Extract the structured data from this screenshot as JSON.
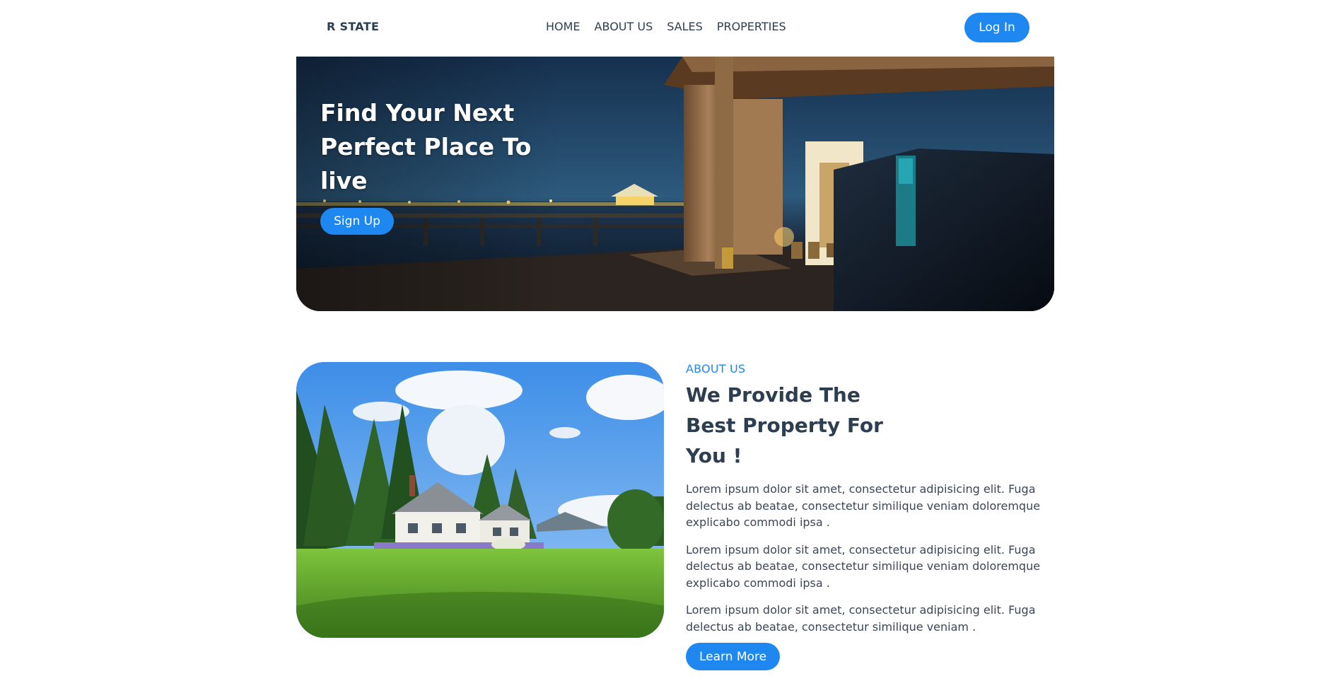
{
  "navbar": {
    "brand": "R STATE",
    "links": [
      "HOME",
      "ABOUT US",
      "SALES",
      "PROPERTIES"
    ],
    "login_label": "Log In"
  },
  "hero": {
    "title": "Find Your Next Perfect Place To live",
    "signup_label": "Sign Up"
  },
  "about": {
    "eyebrow": "ABOUT US",
    "heading": "We Provide The Best Property For You !",
    "paragraphs": [
      "Lorem ipsum dolor sit amet, consectetur adipisicing elit. Fuga delectus ab beatae, consectetur similique veniam doloremque explicabo commodi ipsa .",
      "Lorem ipsum dolor sit amet, consectetur adipisicing elit. Fuga delectus ab beatae, consectetur similique veniam doloremque explicabo commodi ipsa .",
      "Lorem ipsum dolor sit amet, consectetur adipisicing elit. Fuga delectus ab beatae, consectetur similique veniam ."
    ],
    "learn_more_label": "Learn More"
  },
  "colors": {
    "accent": "#1e88f0",
    "heading": "#2c3e50",
    "body_text": "#3b4656",
    "background": "#ffffff"
  }
}
